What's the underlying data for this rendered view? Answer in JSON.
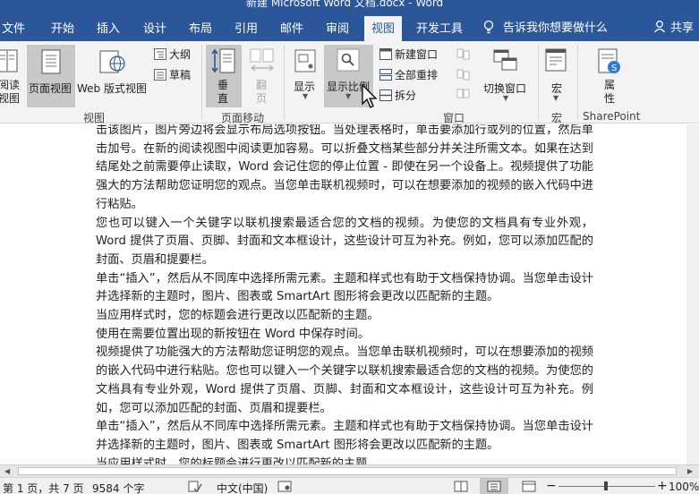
{
  "window": {
    "title": "新建 Microsoft Word 文档.docx  -  Word"
  },
  "tabs": [
    {
      "label": "文件"
    },
    {
      "label": "开始"
    },
    {
      "label": "插入"
    },
    {
      "label": "设计"
    },
    {
      "label": "布局"
    },
    {
      "label": "引用"
    },
    {
      "label": "邮件"
    },
    {
      "label": "审阅"
    },
    {
      "label": "视图"
    },
    {
      "label": "开发工具"
    }
  ],
  "active_tab": "视图",
  "tell_me": {
    "placeholder": "告诉我你想要做什么"
  },
  "share": {
    "label": "共享"
  },
  "ribbon": {
    "views": {
      "read_mode": "阅读\n视图",
      "print_layout": "页面视图",
      "web_layout": "Web 版式视图",
      "outline": "大纲",
      "draft": "草稿",
      "group": "视图"
    },
    "page_movement": {
      "vertical": "垂\n直",
      "side_by_side": "翻\n页",
      "group": "页面移动"
    },
    "show": {
      "label": "显示"
    },
    "zoom": {
      "label": "显示比例"
    },
    "window": {
      "new_window": "新建窗口",
      "arrange_all": "全部重排",
      "split": "拆分",
      "switch_windows": "切换窗口",
      "group": "窗口"
    },
    "macros": {
      "label": "宏",
      "group": "宏"
    },
    "sharepoint": {
      "label": "属\n性",
      "group": "SharePoint"
    }
  },
  "document": {
    "paragraphs": [
      "击该图片，图片旁边将会显示布局选项按钮。当处理表格时，单击要添加行或列的位置，然后单击加号。在新的阅读视图中阅读更加容易。可以折叠文档某些部分并关注所需文本。如果在达到结尾处之前需要停止读取，Word 会记住您的停止位置 - 即使在另一个设备上。视频提供了功能强大的方法帮助您证明您的观点。当您单击联机视频时，可以在想要添加的视频的嵌入代码中进行粘贴。",
      "您也可以键入一个关键字以联机搜索最适合您的文档的视频。为使您的文档具有专业外观，Word 提供了页眉、页脚、封面和文本框设计，这些设计可互为补充。例如，您可以添加匹配的封面、页眉和提要栏。",
      "单击“插入”，然后从不同库中选择所需元素。主题和样式也有助于文档保持协调。当您单击设计并选择新的主题时，图片、图表或 SmartArt 图形将会更改以匹配新的主题。",
      "当应用样式时，您的标题会进行更改以匹配新的主题。",
      "使用在需要位置出现的新按钮在 Word 中保存时间。",
      "视频提供了功能强大的方法帮助您证明您的观点。当您单击联机视频时，可以在想要添加的视频的嵌入代码中进行粘贴。您也可以键入一个关键字以联机搜索最适合您的文档的视频。为使您的文档具有专业外观，Word 提供了页眉、页脚、封面和文本框设计，这些设计可互为补充。例如，您可以添加匹配的封面、页眉和提要栏。",
      "单击“插入”，然后从不同库中选择所需元素。主题和样式也有助于文档保持协调。当您单击设计并选择新的主题时，图片、图表或 SmartArt 图形将会更改以匹配新的主题。",
      "当应用样式时，您的标题会进行更改以匹配新的主题。"
    ]
  },
  "status": {
    "page": "第 1 页，共 7 页",
    "words": "9584 个字",
    "language": "中文(中国)",
    "zoom": "100%"
  },
  "colors": {
    "ribbon_blue": "#2b579a",
    "ribbon_bg": "#f3f3f3"
  }
}
